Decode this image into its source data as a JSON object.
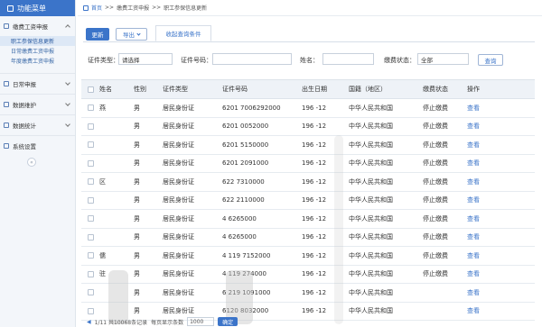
{
  "sidebar": {
    "title": "功能菜单",
    "groups": [
      {
        "label": "缴费工资申报",
        "expanded": true
      },
      {
        "label": "日常申报"
      },
      {
        "label": "数据维护"
      },
      {
        "label": "数据统计"
      },
      {
        "label": "系统设置"
      }
    ],
    "subitems": [
      "职工参保信息更新",
      "日常缴费工资申报",
      "年度缴费工资申报"
    ],
    "collapse_glyph": "«"
  },
  "breadcrumb": {
    "home": "首页",
    "sep": ">>",
    "level1": "缴费工资申报",
    "level2": "职工参保信息更新"
  },
  "toolbar": {
    "update_label": "更新",
    "export_label": "导出",
    "filter_tab": "收起查询条件"
  },
  "filters": {
    "id_type_label": "证件类型：",
    "id_type_value": "请选择",
    "id_no_label": "证件号码：",
    "id_no_value": "",
    "name_label": "姓名：",
    "name_value": "",
    "status_label": "缴费状态：",
    "status_value": "全部",
    "query_label": "查询"
  },
  "table": {
    "headers": [
      "姓名",
      "性别",
      "证件类型",
      "证件号码",
      "出生日期",
      "国籍（地区）",
      "缴费状态",
      "操作"
    ],
    "rows": [
      {
        "name": "燕",
        "gender": "男",
        "idtype": "居民身份证",
        "idno": "6201   7006292000",
        "birth": "196   -12",
        "country": "中华人民共和国",
        "status": "停止缴费",
        "op": "查看"
      },
      {
        "name": "",
        "gender": "男",
        "idtype": "居民身份证",
        "idno": "6201   0052000",
        "birth": "196   -12",
        "country": "中华人民共和国",
        "status": "停止缴费",
        "op": "查看"
      },
      {
        "name": "",
        "gender": "男",
        "idtype": "居民身份证",
        "idno": "6201   5150000",
        "birth": "196   -12",
        "country": "中华人民共和国",
        "status": "停止缴费",
        "op": "查看"
      },
      {
        "name": "",
        "gender": "男",
        "idtype": "居民身份证",
        "idno": "6201   2091000",
        "birth": "196   -12",
        "country": "中华人民共和国",
        "status": "停止缴费",
        "op": "查看"
      },
      {
        "name": "区",
        "gender": "男",
        "idtype": "居民身份证",
        "idno": "622   7310000",
        "birth": "196   -12",
        "country": "中华人民共和国",
        "status": "停止缴费",
        "op": "查看"
      },
      {
        "name": "",
        "gender": "男",
        "idtype": "居民身份证",
        "idno": "622   2110000",
        "birth": "196   -12",
        "country": "中华人民共和国",
        "status": "停止缴费",
        "op": "查看"
      },
      {
        "name": "",
        "gender": "男",
        "idtype": "居民身份证",
        "idno": "4   6265000",
        "birth": "196   -12",
        "country": "中华人民共和国",
        "status": "停止缴费",
        "op": "查看"
      },
      {
        "name": "",
        "gender": "男",
        "idtype": "居民身份证",
        "idno": "4   6265000",
        "birth": "196   -12",
        "country": "中华人民共和国",
        "status": "停止缴费",
        "op": "查看"
      },
      {
        "name": "儒",
        "gender": "男",
        "idtype": "居民身份证",
        "idno": "4   119   7152000",
        "birth": "196   -12",
        "country": "中华人民共和国",
        "status": "停止缴费",
        "op": "查看"
      },
      {
        "name": "驻",
        "gender": "男",
        "idtype": "居民身份证",
        "idno": "4   119   274000",
        "birth": "196   -12",
        "country": "中华人民共和国",
        "status": "停止缴费",
        "op": "查看"
      },
      {
        "name": "",
        "gender": "男",
        "idtype": "居民身份证",
        "idno": "6   219   1091000",
        "birth": "196   -12",
        "country": "中华人民共和国",
        "status": "",
        "op": "查看"
      },
      {
        "name": "",
        "gender": "男",
        "idtype": "居民身份证",
        "idno": "6120   8032000",
        "birth": "196   -12",
        "country": "中华人民共和国",
        "status": "",
        "op": "查看"
      }
    ]
  },
  "pager": {
    "prev": "◀",
    "info": "1/11  共10068条记录",
    "per_page_label": "每页显示条数",
    "per_page_value": "1000",
    "ok_label": "确定"
  },
  "colors": {
    "accent": "#3b74c9",
    "header_bg": "#eef2f7",
    "sidebar_bg": "#f3f6fa"
  }
}
